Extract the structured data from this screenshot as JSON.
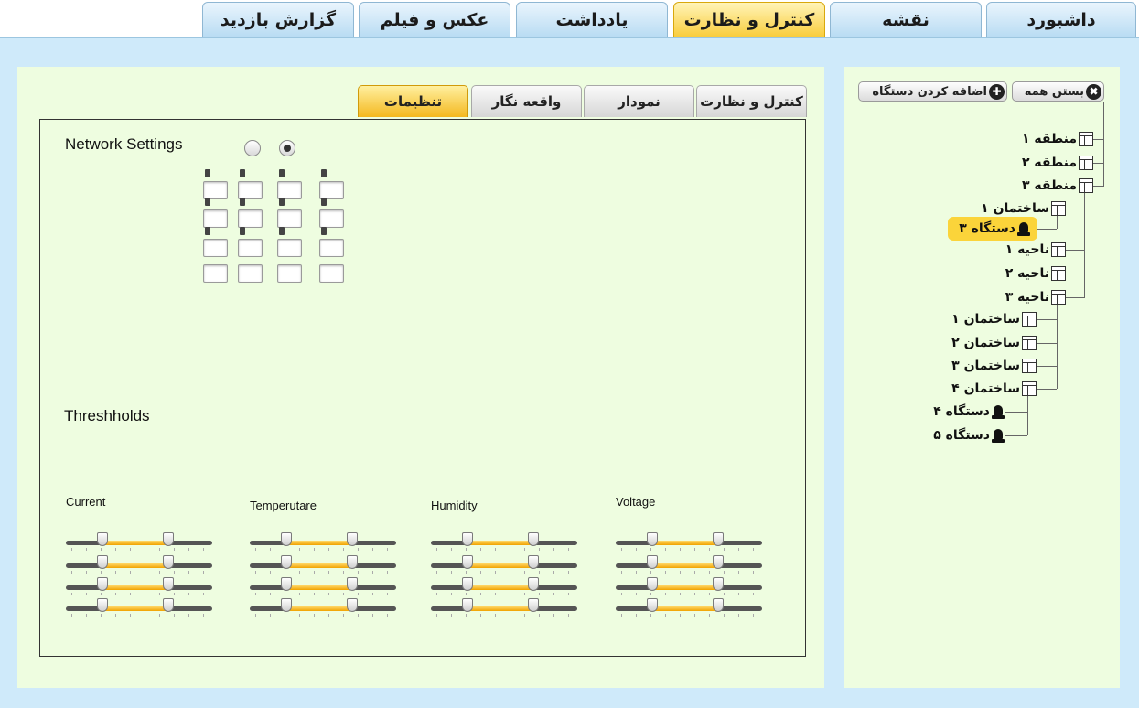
{
  "top_tabs": [
    {
      "label": "داشبورد",
      "active": false
    },
    {
      "label": "نقشه",
      "active": false
    },
    {
      "label": "کنترل و نظارت",
      "active": true
    },
    {
      "label": "یادداشت",
      "active": false
    },
    {
      "label": "عکس و فیلم",
      "active": false
    },
    {
      "label": "گزارش بازدید",
      "active": false
    }
  ],
  "tree_toolbar": {
    "close_all": "بستن همه",
    "add_device": "اضافه کردن دستگاه"
  },
  "tree": [
    {
      "label": "منطقه ۱",
      "icon": "table-icon"
    },
    {
      "label": "منطقه ۲",
      "icon": "table-icon"
    },
    {
      "label": "منطقه ۳",
      "icon": "table-icon"
    },
    {
      "label": "ساختمان ۱",
      "icon": "table-icon"
    },
    {
      "label": "دستگاه ۳",
      "icon": "device-icon",
      "selected": true
    },
    {
      "label": "ناحیه ۱",
      "icon": "table-icon"
    },
    {
      "label": "ناحیه ۲",
      "icon": "table-icon"
    },
    {
      "label": "ناحیه ۳",
      "icon": "table-icon"
    },
    {
      "label": "ساختمان ۱",
      "icon": "table-icon"
    },
    {
      "label": "ساختمان ۲",
      "icon": "table-icon"
    },
    {
      "label": "ساختمان ۳",
      "icon": "table-icon"
    },
    {
      "label": "ساختمان ۴",
      "icon": "table-icon"
    },
    {
      "label": "دستگاه ۴",
      "icon": "device-icon"
    },
    {
      "label": "دستگاه ۵",
      "icon": "device-icon"
    }
  ],
  "inner_tabs": [
    {
      "label": "کنترل و نظارت",
      "active": false
    },
    {
      "label": "نمودار",
      "active": false
    },
    {
      "label": "واقعه نگار",
      "active": false
    },
    {
      "label": "تنظیمات",
      "active": true
    }
  ],
  "network": {
    "title": "Network Settings",
    "radio_selected": 1
  },
  "thresholds": {
    "title": "Threshholds",
    "groups": [
      {
        "label": "Current",
        "ranges": [
          [
            0.25,
            0.7
          ],
          [
            0.25,
            0.7
          ],
          [
            0.25,
            0.7
          ],
          [
            0.25,
            0.7
          ]
        ]
      },
      {
        "label": "Temperutare",
        "ranges": [
          [
            0.25,
            0.7
          ],
          [
            0.25,
            0.7
          ],
          [
            0.25,
            0.7
          ],
          [
            0.25,
            0.7
          ]
        ]
      },
      {
        "label": "Humidity",
        "ranges": [
          [
            0.25,
            0.7
          ],
          [
            0.25,
            0.7
          ],
          [
            0.25,
            0.7
          ],
          [
            0.25,
            0.7
          ]
        ]
      },
      {
        "label": "Voltage",
        "ranges": [
          [
            0.25,
            0.7
          ],
          [
            0.25,
            0.7
          ],
          [
            0.25,
            0.7
          ],
          [
            0.25,
            0.7
          ]
        ]
      }
    ]
  },
  "colors": {
    "accent": "#f9cd3d",
    "tab_blue": "#b9dcf3",
    "panel": "#eefde0",
    "background": "#cfeafa"
  }
}
